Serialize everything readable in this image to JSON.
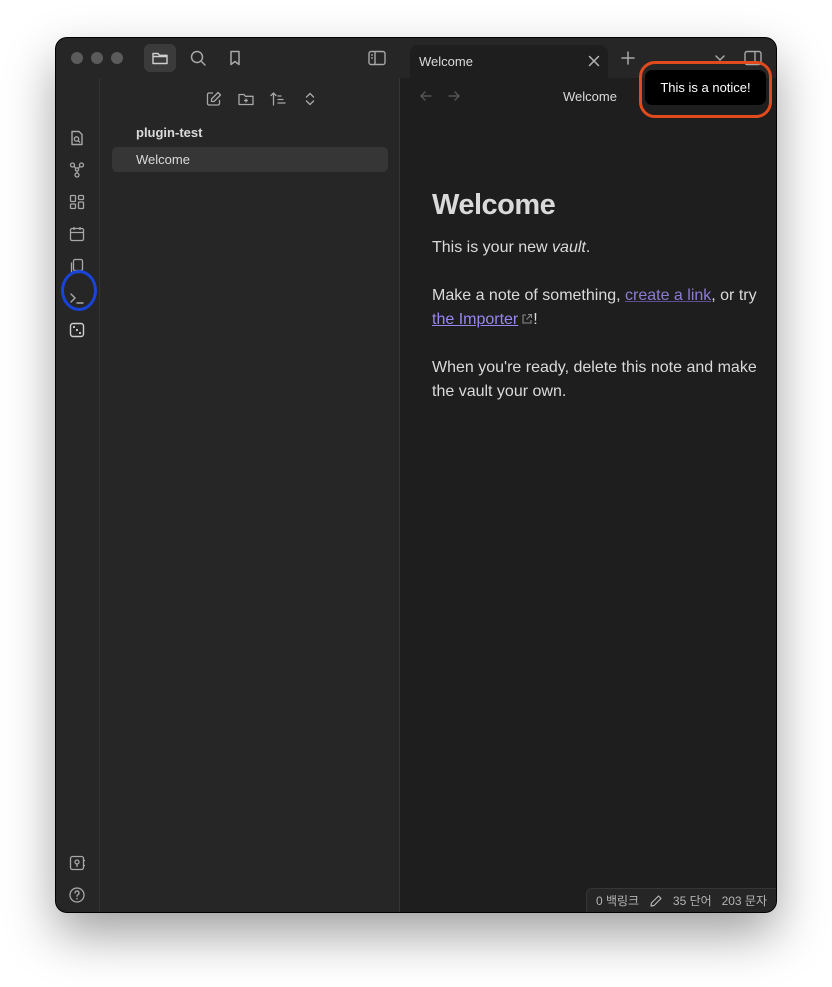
{
  "colors": {
    "window_bg": "#1e1e1e",
    "panel_bg": "#262626",
    "text": "#dadada",
    "internal_link": "#8d7bd3",
    "external_link": "#9a86f0",
    "notice_ring": "#e04a1c",
    "ribbon_highlight_ring": "#1844d8"
  },
  "titlebar": {
    "buttons": [
      "files-icon",
      "search-icon",
      "bookmark-icon",
      "sidebar-toggle-icon"
    ],
    "tab": {
      "title": "Welcome"
    },
    "new_tab_icon": "plus-icon",
    "right_icons": [
      "chevron-down-icon",
      "right-sidebar-toggle-icon"
    ]
  },
  "ribbon": {
    "icons": [
      "quick-switcher-icon",
      "graph-view-icon",
      "canvas-icon",
      "daily-note-icon",
      "templates-icon",
      "command-palette-icon",
      "random-note-dice-icon"
    ],
    "bottom_icons": [
      "vault-switcher-icon",
      "help-icon",
      "settings-gear-icon"
    ]
  },
  "sidebar": {
    "tools": [
      "new-note-icon",
      "new-folder-icon",
      "sort-icon",
      "collapse-expand-icon"
    ],
    "vault_name": "plugin-test",
    "files": [
      {
        "label": "Welcome"
      }
    ]
  },
  "main": {
    "view_title": "Welcome",
    "heading": "Welcome",
    "p1_prefix": "This is your new ",
    "p1_em": "vault",
    "p1_suffix": ".",
    "p2_prefix": "Make a note of something, ",
    "p2_link": "create a link",
    "p2_middle": ", or try ",
    "p2_external": "the Importer",
    "p2_suffix": "!",
    "p3": "When you're ready, delete this note and make the vault your own."
  },
  "statusbar": {
    "backlinks": "0 백링크",
    "words": "35 단어",
    "chars": "203 문자"
  },
  "notice": {
    "text": "This is a notice!"
  }
}
